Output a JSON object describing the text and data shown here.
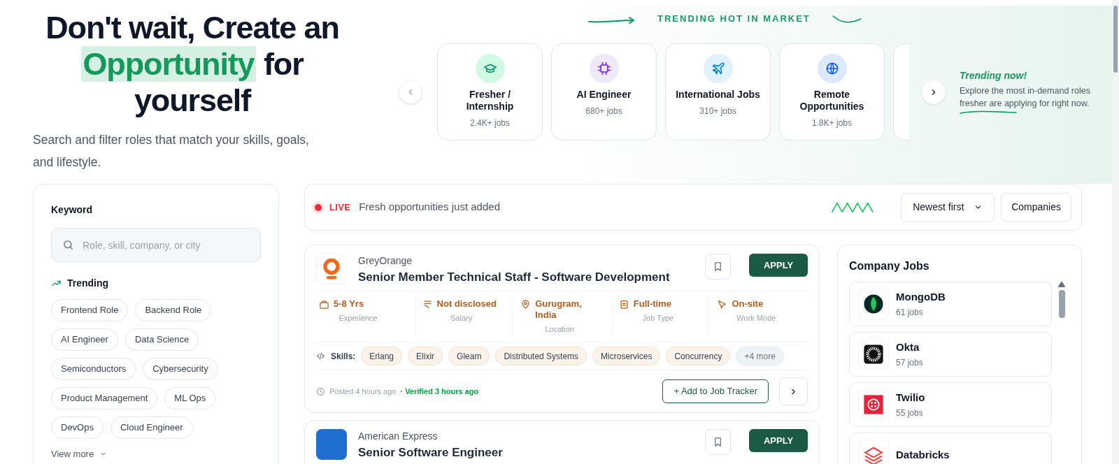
{
  "hero": {
    "headline_start": "Don't wait, Create an",
    "headline_highlight": "Opportunity",
    "headline_end": "for yourself",
    "subtitle": "Search and filter roles that match your skills, goals, and lifestyle."
  },
  "trending_market": {
    "heading": "TRENDING HOT IN MARKET",
    "cards": [
      {
        "kind": "graduation",
        "color": "#d1fae5",
        "title": "Fresher / Internship",
        "count": "2.4K+ jobs"
      },
      {
        "kind": "chip",
        "color": "#ede9fe",
        "title": "AI Engineer",
        "count": "680+ jobs"
      },
      {
        "kind": "plane",
        "color": "#e0f2fe",
        "title": "International Jobs",
        "count": "310+ jobs"
      },
      {
        "kind": "globe",
        "color": "#dbeafe",
        "title": "Remote Opportunities",
        "count": "1.8K+ jobs"
      }
    ],
    "note_title": "Trending now!",
    "note_text": "Explore the most in-demand roles fresher are applying for right now."
  },
  "filters": {
    "keyword_label": "Keyword",
    "search": {
      "placeholder": "Role, skill, company, or city"
    },
    "trending_label": "Trending",
    "tags": [
      "Frontend Role",
      "Backend Role",
      "AI Engineer",
      "Data Science",
      "Semiconductors",
      "Cybersecurity",
      "Product Management",
      "ML Ops",
      "DevOps",
      "Cloud Engineer"
    ],
    "view_more": "View more"
  },
  "live_bar": {
    "badge": "LIVE",
    "text": "Fresh opportunities just added",
    "sort": "Newest first",
    "companies_button": "Companies"
  },
  "jobs": [
    {
      "kind": "greyorange",
      "company": "GreyOrange",
      "title": "Senior Member Technical Staff - Software Development",
      "apply": "APPLY",
      "meta": [
        {
          "kind": "bag",
          "value": "5-8 Yrs",
          "label": "Experience"
        },
        {
          "kind": "salary",
          "value": "Not disclosed",
          "label": "Salary"
        },
        {
          "kind": "pin",
          "value": "Gurugram, India",
          "label": "Location"
        },
        {
          "kind": "doc",
          "value": "Full-time",
          "label": "Job Type"
        },
        {
          "kind": "cursor",
          "value": "On-site",
          "label": "Work Mode"
        }
      ],
      "skills_label": "Skills:",
      "skills": [
        "Erlang",
        "Elixir",
        "Gleam",
        "Distributed Systems",
        "Microservices",
        "Concurrency"
      ],
      "more_skills": "+4 more",
      "posted": "Posted 4 hours ago",
      "verified": "· Verified 3 hours ago",
      "tracker": "+ Add to Job Tracker"
    },
    {
      "kind": "amex",
      "company": "American Express",
      "title": "Senior Software Engineer",
      "apply": "APPLY"
    }
  ],
  "company_jobs": {
    "title": "Company Jobs",
    "items": [
      {
        "kind": "leaf",
        "name": "MongoDB",
        "count": "61 jobs"
      },
      {
        "kind": "sunburst",
        "name": "Okta",
        "count": "57 jobs"
      },
      {
        "kind": "twilio",
        "name": "Twilio",
        "count": "55 jobs"
      },
      {
        "kind": "stack",
        "name": "Databricks"
      }
    ]
  }
}
